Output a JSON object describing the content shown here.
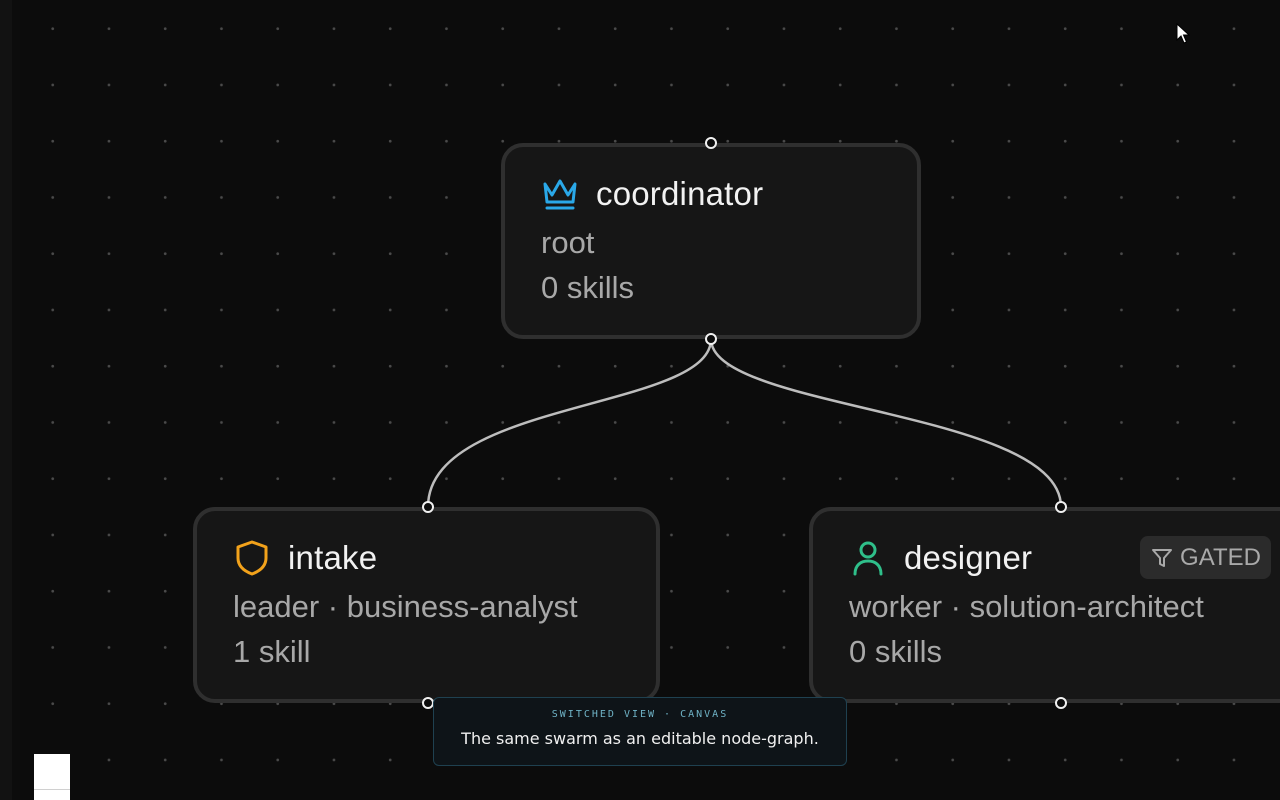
{
  "canvas": {
    "nodes": [
      {
        "title": "coordinator",
        "subtitle": "root",
        "skills": "0 skills",
        "icon": "crown-icon",
        "color": "#2aa8e8"
      },
      {
        "title": "intake",
        "subtitle": "leader · business-analyst",
        "skills": "1 skill",
        "icon": "shield-icon",
        "color": "#f2a21b"
      },
      {
        "title": "designer",
        "subtitle": "worker · solution-architect",
        "skills": "0 skills",
        "icon": "person-icon",
        "color": "#2fbf8a",
        "badge": "GATED"
      }
    ],
    "edges": [
      {
        "from": "coordinator",
        "to": "intake"
      },
      {
        "from": "coordinator",
        "to": "designer"
      }
    ]
  },
  "toast": {
    "title": "SWITCHED VIEW · CANVAS",
    "message": "The same swarm as an editable node-graph."
  }
}
